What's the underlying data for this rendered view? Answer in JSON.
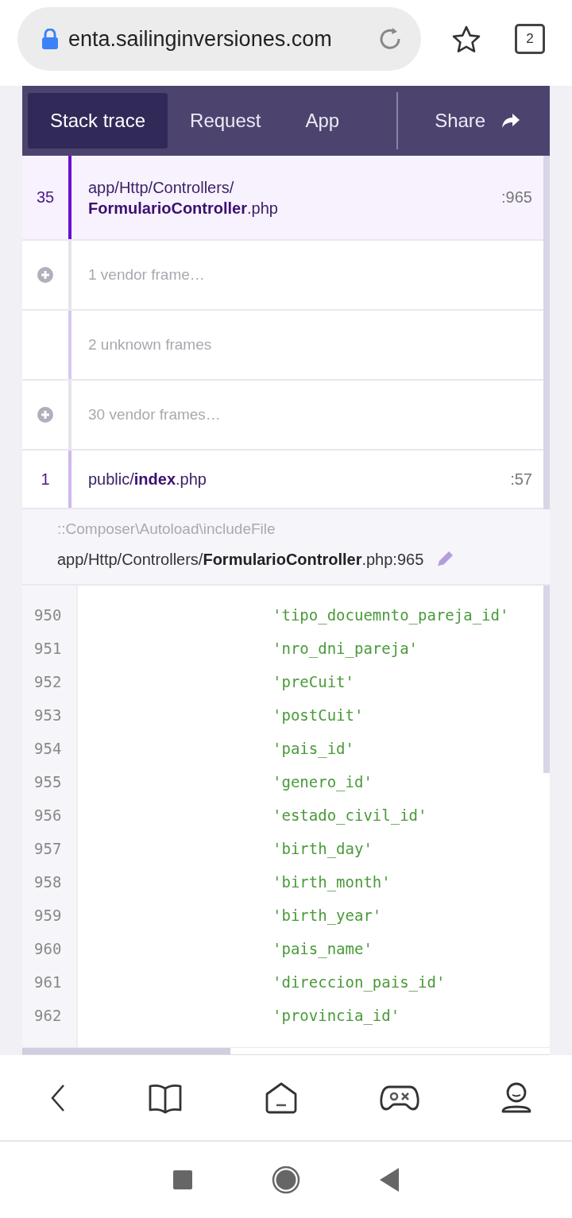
{
  "address_bar": {
    "url": "enta.sailinginversiones.com",
    "tab_count": "2"
  },
  "tabs": [
    {
      "label": "Stack trace",
      "selected": true
    },
    {
      "label": "Request",
      "selected": false
    },
    {
      "label": "App",
      "selected": false
    }
  ],
  "share_button": {
    "label": "Share"
  },
  "frames": [
    {
      "kind": "app",
      "number": "35",
      "file": "app/Http/Controllers/**FormularioController**.php",
      "line": ":965",
      "selected": true
    },
    {
      "kind": "vendor",
      "text": "1 vendor frame…"
    },
    {
      "kind": "unknown",
      "text": "2 unknown frames"
    },
    {
      "kind": "vendor",
      "text": "30 vendor frames…"
    },
    {
      "kind": "app",
      "number": "1",
      "file": "public/**index**.php",
      "line": ":57",
      "selected": false
    }
  ],
  "exception": {
    "method": "::Composer\\Autoload\\includeFile",
    "location": "app/Http/Controllers/**FormularioController**.php:965"
  },
  "code_lines": [
    {
      "number": "950",
      "code": "'tipo_docuemnto_pareja_id'"
    },
    {
      "number": "951",
      "code": "'nro_dni_pareja'"
    },
    {
      "number": "952",
      "code": "'preCuit'"
    },
    {
      "number": "953",
      "code": "'postCuit'"
    },
    {
      "number": "954",
      "code": "'pais_id'"
    },
    {
      "number": "955",
      "code": "'genero_id'"
    },
    {
      "number": "956",
      "code": "'estado_civil_id'"
    },
    {
      "number": "957",
      "code": "'birth_day'"
    },
    {
      "number": "958",
      "code": "'birth_month'"
    },
    {
      "number": "959",
      "code": "'birth_year'"
    },
    {
      "number": "960",
      "code": "'pais_name'"
    },
    {
      "number": "961",
      "code": "'direccion_pais_id'"
    },
    {
      "number": "962",
      "code": "'provincia_id'"
    }
  ]
}
